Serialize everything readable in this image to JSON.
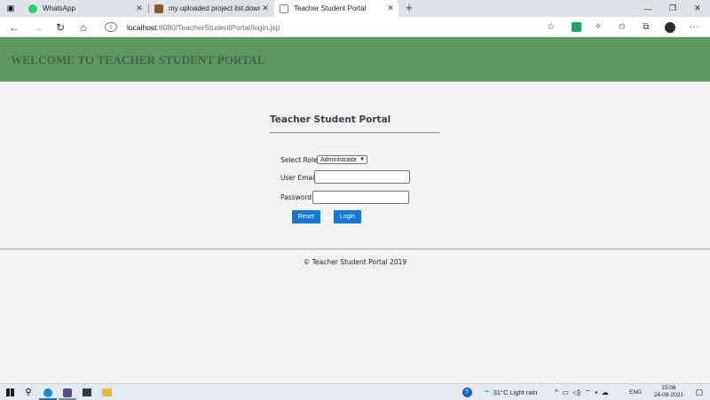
{
  "browser": {
    "tabs": [
      {
        "label": "WhatsApp",
        "icon": "whatsapp-icon",
        "color": "#25d366"
      },
      {
        "label": "my uploaded project list.downlo",
        "icon": "document-icon",
        "color": "#8b5a2b"
      },
      {
        "label": "Teacher Student Portal",
        "icon": "page-icon",
        "color": "#ffffff"
      }
    ],
    "new_tab": "+",
    "close_glyph": "✕",
    "address": {
      "host": "localhost",
      "path": ":8080/TeacherStudentPortal/login.jsp"
    }
  },
  "page": {
    "banner_title": "WELCOME TO TEACHER STUDENT PORTAL",
    "banner_color": "#5d9860",
    "portal_title": "Teacher Student Portal",
    "form": {
      "role_label": "Select Role :",
      "role_value": "Administrator",
      "email_label": "User Email:",
      "email_value": "",
      "password_label": "Password :",
      "password_value": "",
      "reset_label": "Reset",
      "login_label": "Login"
    },
    "footer": "©  Teacher Student Portal 2019",
    "button_color": "#1877d2"
  },
  "taskbar": {
    "weather": "31°C  Light rain",
    "language": "ENG",
    "time": "15:08",
    "date": "24-08-2021"
  }
}
